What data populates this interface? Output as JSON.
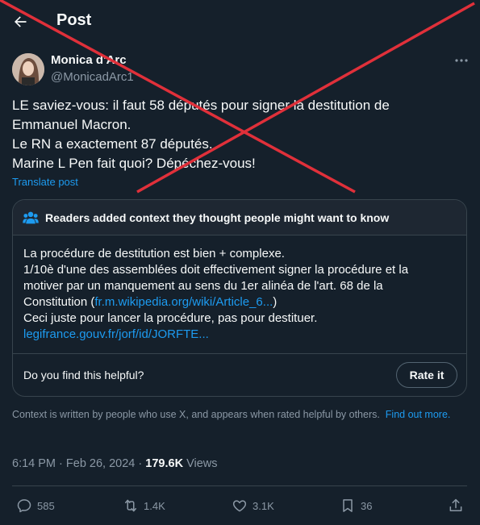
{
  "header": {
    "title": "Post"
  },
  "author": {
    "name": "Monica d'Arc",
    "handle": "@MonicadArc1"
  },
  "post": {
    "lines": [
      "LE saviez-vous: il faut 58 députés pour signer la destitution de",
      "Emmanuel Macron.",
      "Le RN a exactement 87 députés.",
      "Marine L Pen fait quoi? Dépéchez-vous!"
    ],
    "translate_label": "Translate post"
  },
  "community_note": {
    "heading": "Readers added context they thought people might want to know",
    "lines": {
      "l1": "La procédure de destitution est bien + complexe.",
      "l2": "1/10è d'une des assemblées doit effectivement signer la procédure et la",
      "l3": "motiver par un manquement au sens du 1er alinéa de l'art. 68 de la",
      "l4_prefix": "Constitution (",
      "l4_link": "fr.m.wikipedia.org/wiki/Article_6...",
      "l4_suffix": ")",
      "l5": "Ceci juste pour lancer la procédure, pas pour destituer.",
      "l6_link": "legifrance.gouv.fr/jorf/id/JORFTE..."
    },
    "helpful_question": "Do you find this helpful?",
    "rate_button": "Rate it"
  },
  "context_info": {
    "text": "Context is written by people who use X, and appears when rated helpful by others.",
    "link": "Find out more."
  },
  "meta": {
    "time": "6:14 PM",
    "date": "Feb 26, 2024",
    "separator": "·",
    "views_count": "179.6K",
    "views_label": "Views"
  },
  "actions": {
    "replies": "585",
    "reposts": "1.4K",
    "likes": "3.1K",
    "bookmarks": "36"
  },
  "colors": {
    "background": "#15202b",
    "accent": "#1d9bf0",
    "muted": "#8b98a5",
    "strike": "#e0303a"
  },
  "icons": [
    "back-arrow-icon",
    "more-icon",
    "people-icon",
    "reply-icon",
    "repost-icon",
    "like-icon",
    "bookmark-icon",
    "share-icon"
  ]
}
